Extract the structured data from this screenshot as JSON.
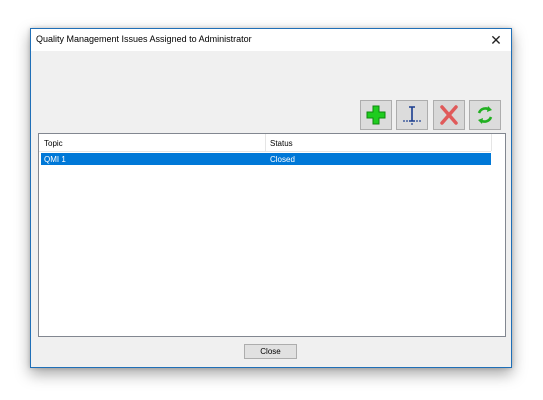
{
  "window": {
    "title": "Quality Management Issues Assigned to Administrator",
    "close_glyph": "✕"
  },
  "toolbar": {
    "buttons": [
      {
        "name": "add-button",
        "icon": "green-plus-icon",
        "color": "#18b818"
      },
      {
        "name": "edit-button",
        "icon": "text-cursor-icon",
        "color": "#1a3d8f"
      },
      {
        "name": "delete-button",
        "icon": "red-x-icon",
        "color": "#d94848"
      },
      {
        "name": "refresh-button",
        "icon": "green-refresh-icon",
        "color": "#22b022"
      }
    ]
  },
  "list": {
    "columns": [
      "Topic",
      "Status"
    ],
    "rows": [
      {
        "topic": "QMI 1",
        "status": "Closed",
        "selected": true
      }
    ],
    "selection_color": "#0078d7"
  },
  "footer": {
    "close_label": "Close"
  }
}
